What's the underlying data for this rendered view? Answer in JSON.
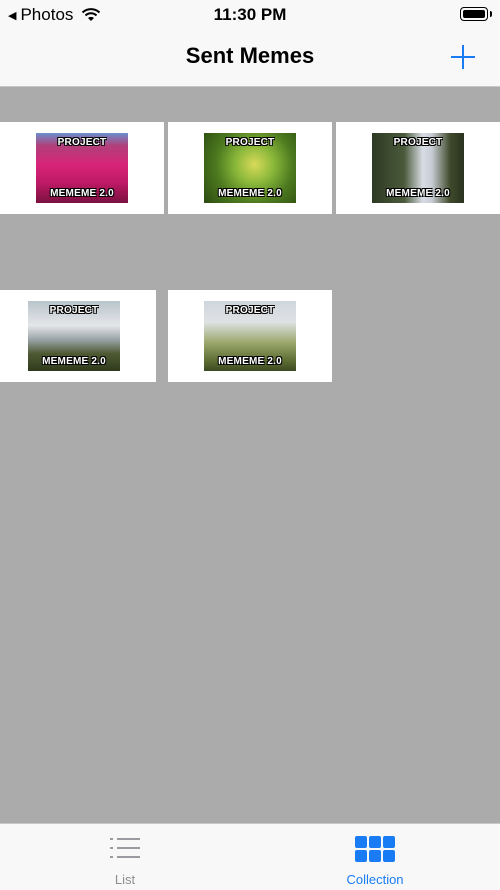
{
  "status_bar": {
    "back_label": "Photos",
    "time": "11:30 PM"
  },
  "nav": {
    "title": "Sent Memes",
    "add_icon": "plus-icon"
  },
  "memes": [
    {
      "top_text": "PROJECT",
      "bottom_text": "MEMEME 2.0",
      "image": "flowers"
    },
    {
      "top_text": "PROJECT",
      "bottom_text": "MEMEME 2.0",
      "image": "leaf"
    },
    {
      "top_text": "PROJECT",
      "bottom_text": "MEMEME 2.0",
      "image": "waterfall"
    },
    {
      "top_text": "PROJECT",
      "bottom_text": "MEMEME 2.0",
      "image": "waterfall-cliff"
    },
    {
      "top_text": "PROJECT",
      "bottom_text": "MEMEME 2.0",
      "image": "grass"
    }
  ],
  "tabs": [
    {
      "label": "List",
      "icon": "list-icon",
      "selected": false
    },
    {
      "label": "Collection",
      "icon": "grid-icon",
      "selected": true
    }
  ],
  "colors": {
    "accent": "#1a7cf5",
    "background": "#ababab",
    "bar": "#f8f8f8"
  }
}
